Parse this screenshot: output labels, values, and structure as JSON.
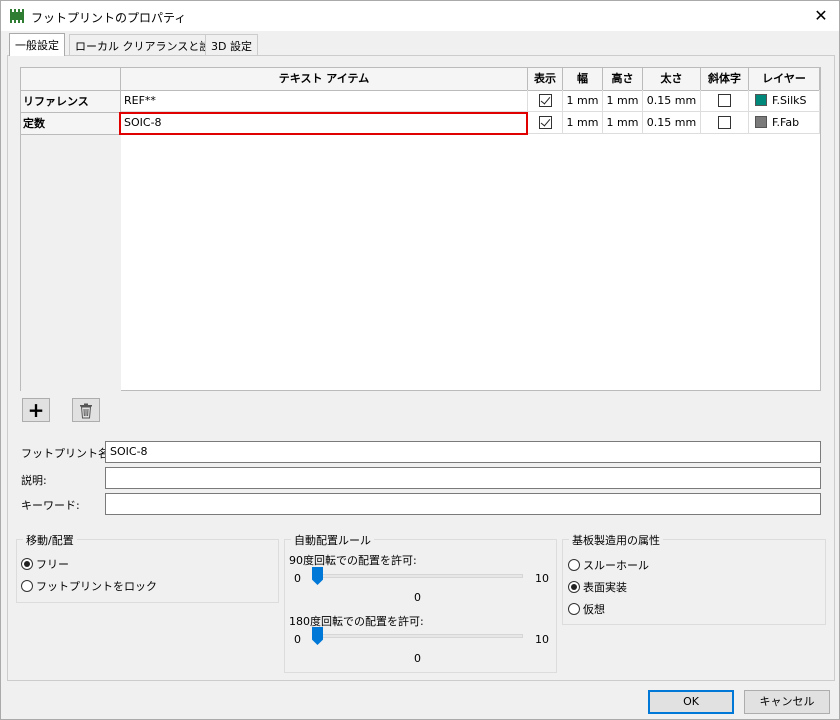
{
  "window": {
    "title": "フットプリントのプロパティ",
    "close": "✕"
  },
  "tabs": [
    {
      "label": "一般設定"
    },
    {
      "label": "ローカル クリアランスと設定"
    },
    {
      "label": "3D 設定"
    }
  ],
  "grid": {
    "headers": [
      "テキスト アイテム",
      "表示",
      "幅",
      "高さ",
      "太さ",
      "斜体字",
      "レイヤー"
    ],
    "rows": [
      {
        "label": "リファレンス",
        "text": "REF**",
        "show": true,
        "width": "1 mm",
        "height": "1 mm",
        "thickness": "0.15 mm",
        "italic": false,
        "layer": "F.SilkS",
        "layer_color": "#00897b"
      },
      {
        "label": "定数",
        "text": "SOIC-8",
        "show": true,
        "width": "1 mm",
        "height": "1 mm",
        "thickness": "0.15 mm",
        "italic": false,
        "layer": "F.Fab",
        "layer_color": "#7a7a7a"
      }
    ]
  },
  "buttons_grid": {
    "add": "+",
    "delete": "🗑"
  },
  "fields": {
    "footprint_name_label": "フットプリント名:",
    "footprint_name_value": "SOIC-8",
    "description_label": "説明:",
    "description_value": "",
    "keywords_label": "キーワード:",
    "keywords_value": ""
  },
  "move_group": {
    "title": "移動/配置",
    "options": [
      {
        "label": "フリー",
        "selected": true
      },
      {
        "label": "フットプリントをロック",
        "selected": false
      }
    ]
  },
  "autoplace_group": {
    "title": "自動配置ルール",
    "slider90": {
      "label": "90度回転での配置を許可:",
      "min": "0",
      "max": "10",
      "value": "0"
    },
    "slider180": {
      "label": "180度回転での配置を許可:",
      "min": "0",
      "max": "10",
      "value": "0"
    }
  },
  "fab_group": {
    "title": "基板製造用の属性",
    "options": [
      {
        "label": "スルーホール",
        "selected": false
      },
      {
        "label": "表面実装",
        "selected": true
      },
      {
        "label": "仮想",
        "selected": false
      }
    ]
  },
  "dialog_buttons": {
    "ok": "OK",
    "cancel": "キャンセル"
  },
  "colors": {
    "selection_border": "#e00000",
    "accent": "#0078d7"
  }
}
